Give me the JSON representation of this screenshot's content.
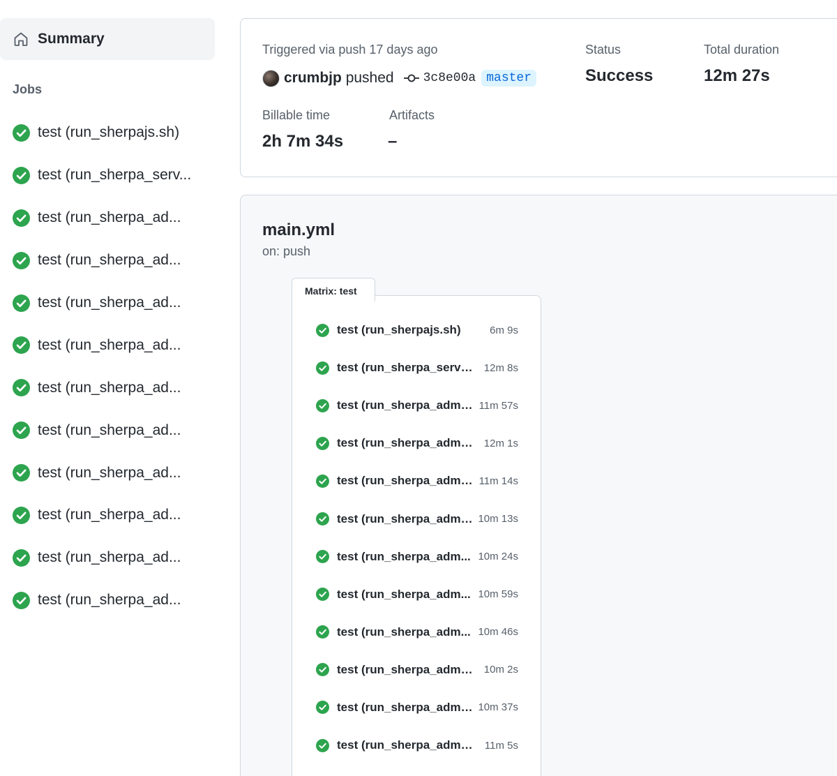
{
  "sidebar": {
    "summary_label": "Summary",
    "jobs_heading": "Jobs",
    "jobs": [
      {
        "label": "test (run_sherpajs.sh)"
      },
      {
        "label": "test (run_sherpa_serv..."
      },
      {
        "label": "test (run_sherpa_ad..."
      },
      {
        "label": "test (run_sherpa_ad..."
      },
      {
        "label": "test (run_sherpa_ad..."
      },
      {
        "label": "test (run_sherpa_ad..."
      },
      {
        "label": "test (run_sherpa_ad..."
      },
      {
        "label": "test (run_sherpa_ad..."
      },
      {
        "label": "test (run_sherpa_ad..."
      },
      {
        "label": "test (run_sherpa_ad..."
      },
      {
        "label": "test (run_sherpa_ad..."
      },
      {
        "label": "test (run_sherpa_ad..."
      }
    ]
  },
  "summary": {
    "triggered": "Triggered via push 17 days ago",
    "pusher": "crumbjp",
    "pushed_word": "pushed",
    "commit_sha": "3c8e00a",
    "branch": "master",
    "status_label": "Status",
    "status_value": "Success",
    "duration_label": "Total duration",
    "duration_value": "12m 27s",
    "billable_label": "Billable time",
    "billable_value": "2h 7m 34s",
    "artifacts_label": "Artifacts",
    "artifacts_value": "–"
  },
  "workflow": {
    "name": "main.yml",
    "trigger": "on: push",
    "matrix_label": "Matrix: test",
    "jobs": [
      {
        "label": "test (run_sherpajs.sh)",
        "duration": "6m 9s"
      },
      {
        "label": "test (run_sherpa_serve...",
        "duration": "12m 8s"
      },
      {
        "label": "test (run_sherpa_admi...",
        "duration": "11m 57s"
      },
      {
        "label": "test (run_sherpa_admin...",
        "duration": "12m 1s"
      },
      {
        "label": "test (run_sherpa_admi...",
        "duration": "11m 14s"
      },
      {
        "label": "test (run_sherpa_admi...",
        "duration": "10m 13s"
      },
      {
        "label": "test (run_sherpa_adm...",
        "duration": "10m 24s"
      },
      {
        "label": "test (run_sherpa_adm...",
        "duration": "10m 59s"
      },
      {
        "label": "test (run_sherpa_adm...",
        "duration": "10m 46s"
      },
      {
        "label": "test (run_sherpa_admi...",
        "duration": "10m 2s"
      },
      {
        "label": "test (run_sherpa_admi...",
        "duration": "10m 37s"
      },
      {
        "label": "test (run_sherpa_admin...",
        "duration": "11m 5s"
      }
    ]
  },
  "icons": {
    "summary": "home-icon",
    "job_status": "check-circle-icon",
    "commit": "git-commit-icon"
  },
  "colors": {
    "success": "#2da44e",
    "branch_text": "#0969da",
    "branch_bg": "#ddf4ff"
  }
}
